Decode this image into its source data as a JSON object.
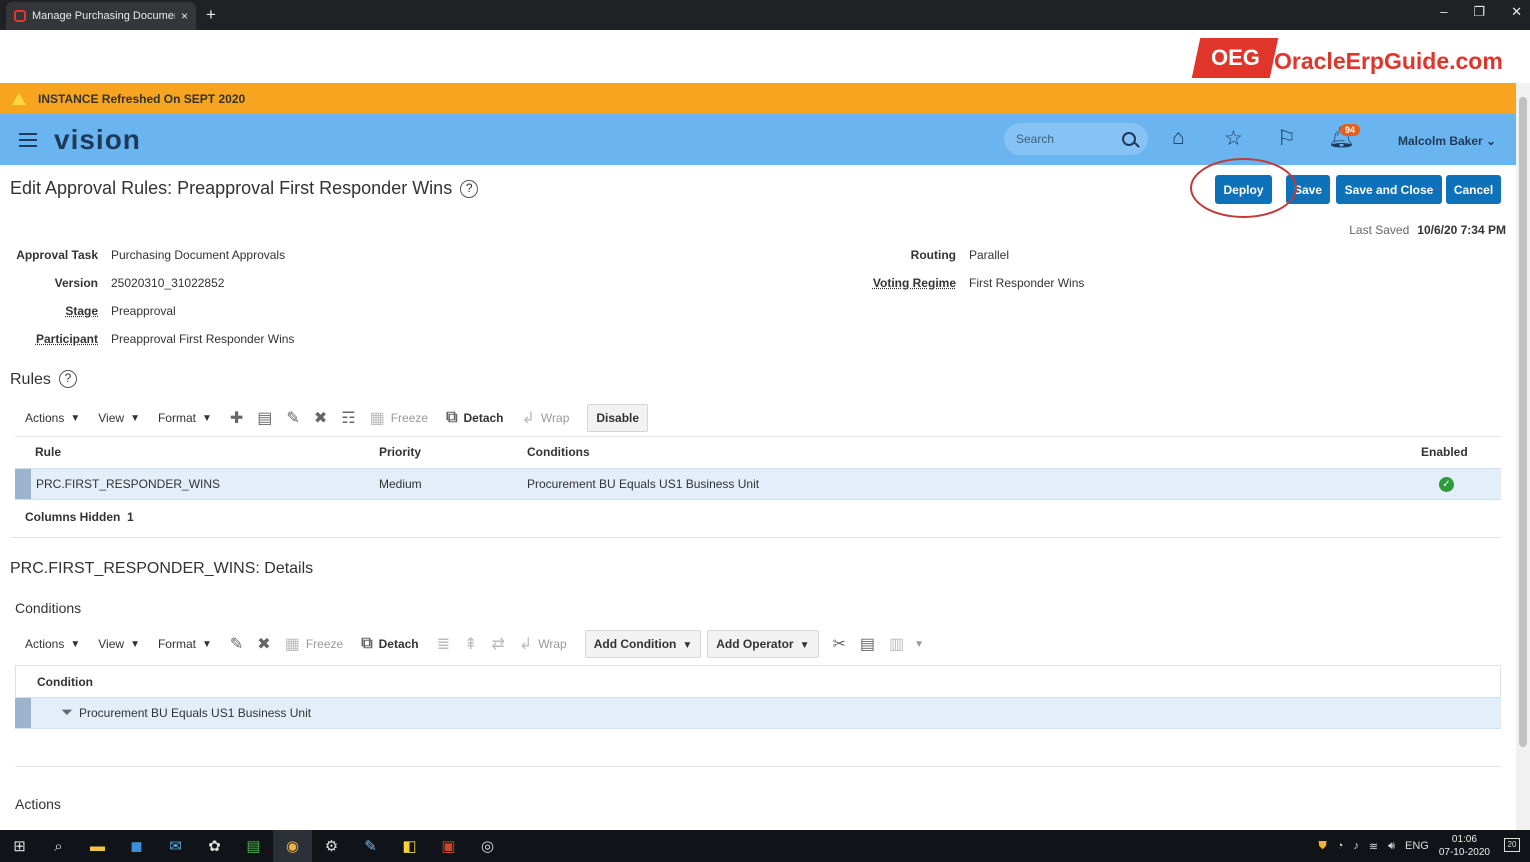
{
  "browser": {
    "tab_title": "Manage Purchasing Document A",
    "new_tab": "+",
    "tab_close": "×",
    "controls": [
      "–",
      "❐",
      "✕"
    ]
  },
  "logo": {
    "mark": "OEG",
    "text": "OracleErpGuide.com"
  },
  "banner": {
    "text": "INSTANCE Refreshed On SEPT 2020"
  },
  "header": {
    "brand": "vision",
    "search_placeholder": "Search",
    "notification_count": "94",
    "user": "Malcolm Baker"
  },
  "page": {
    "title": "Edit Approval Rules: Preapproval First Responder Wins",
    "help": "?",
    "buttons": {
      "deploy": "Deploy",
      "save": "Save",
      "save_close": "Save and Close",
      "cancel": "Cancel"
    },
    "last_saved_label": "Last Saved",
    "last_saved_value": "10/6/20 7:34 PM"
  },
  "fields": {
    "approval_task_label": "Approval Task",
    "approval_task": "Purchasing Document Approvals",
    "version_label": "Version",
    "version": "25020310_31022852",
    "stage_label": "Stage",
    "stage": "Preapproval",
    "participant_label": "Participant",
    "participant": "Preapproval First Responder Wins",
    "routing_label": "Routing",
    "routing": "Parallel",
    "voting_label": "Voting Regime",
    "voting": "First Responder Wins"
  },
  "rules": {
    "title": "Rules",
    "toolbar": {
      "actions": "Actions",
      "view": "View",
      "format": "Format",
      "freeze": "Freeze",
      "detach": "Detach",
      "wrap": "Wrap",
      "disable": "Disable"
    },
    "columns": [
      "Rule",
      "Priority",
      "Conditions",
      "Enabled"
    ],
    "rows": [
      {
        "rule": "PRC.FIRST_RESPONDER_WINS",
        "priority": "Medium",
        "conditions": "Procurement BU Equals US1 Business Unit",
        "enabled": true
      }
    ],
    "columns_hidden_label": "Columns Hidden",
    "columns_hidden_count": "1"
  },
  "details": {
    "title": "PRC.FIRST_RESPONDER_WINS: Details",
    "conditions_title": "Conditions",
    "toolbar": {
      "actions": "Actions",
      "view": "View",
      "format": "Format",
      "freeze": "Freeze",
      "detach": "Detach",
      "wrap": "Wrap",
      "add_condition": "Add Condition",
      "add_operator": "Add Operator"
    },
    "column": "Condition",
    "rows": [
      {
        "condition": "Procurement BU Equals US1 Business Unit"
      }
    ],
    "actions_title": "Actions"
  },
  "taskbar": {
    "language": "ENG",
    "time": "01:06",
    "date": "07-10-2020",
    "notifications": "20"
  }
}
